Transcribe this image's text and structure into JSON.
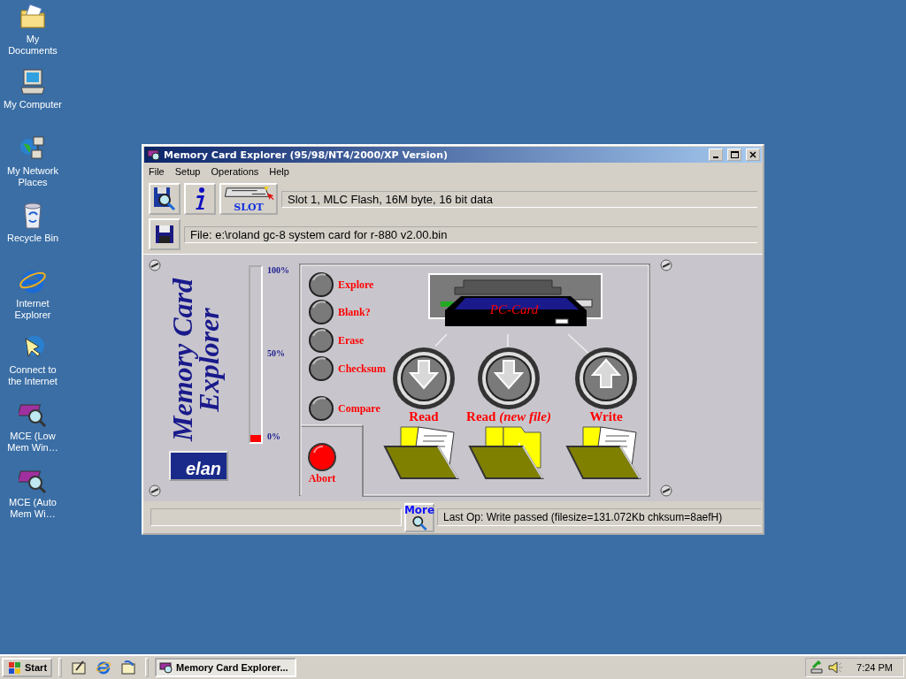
{
  "desktop_icons": [
    {
      "label": "My Documents",
      "kind": "documents"
    },
    {
      "label": "My Computer",
      "kind": "computer"
    },
    {
      "label": "My Network Places",
      "kind": "network"
    },
    {
      "label": "Recycle Bin",
      "kind": "recycle"
    },
    {
      "label": "Internet Explorer",
      "kind": "browser"
    },
    {
      "label": "Connect to the Internet",
      "kind": "connect"
    },
    {
      "label": "MCE (Low Mem Win…",
      "kind": "mce"
    },
    {
      "label": "MCE (Auto Mem Wi…",
      "kind": "mce"
    }
  ],
  "window": {
    "title": "Memory Card Explorer (95/98/NT4/2000/XP Version)",
    "menu": [
      "File",
      "Setup",
      "Operations",
      "Help"
    ],
    "slot_button": "SLOT",
    "slot_info": "Slot 1, MLC Flash, 16M byte, 16 bit data",
    "file_info": "File: e:\\roland gc-8 system card for r-880 v2.00.bin",
    "panel": {
      "logo_lines": [
        "Memory Card",
        "Explorer"
      ],
      "brand": "elan",
      "progress": {
        "level": 0.04,
        "ticks": [
          "100%",
          "50%",
          "0%"
        ]
      },
      "actions": [
        "Explore",
        "Blank?",
        "Erase",
        "Checksum",
        "Compare"
      ],
      "abort": "Abort",
      "card_label": "PC-Card",
      "transfers": [
        {
          "label": "Read",
          "kind": "read"
        },
        {
          "label": "Read *(new file)*",
          "kind": "read_new"
        },
        {
          "label": "Write",
          "kind": "write"
        }
      ]
    },
    "more_button": "More",
    "last_op": "Last Op:  Write passed (filesize=131.072Kb  chksum=8aefH)"
  },
  "taskbar": {
    "start": "Start",
    "quick_launch": [
      {
        "kind": "desktop"
      },
      {
        "kind": "browser"
      },
      {
        "kind": "channels"
      }
    ],
    "tasks": [
      {
        "label": "Memory Card Explorer...",
        "selected": true
      }
    ],
    "clock": "7:24 PM"
  }
}
